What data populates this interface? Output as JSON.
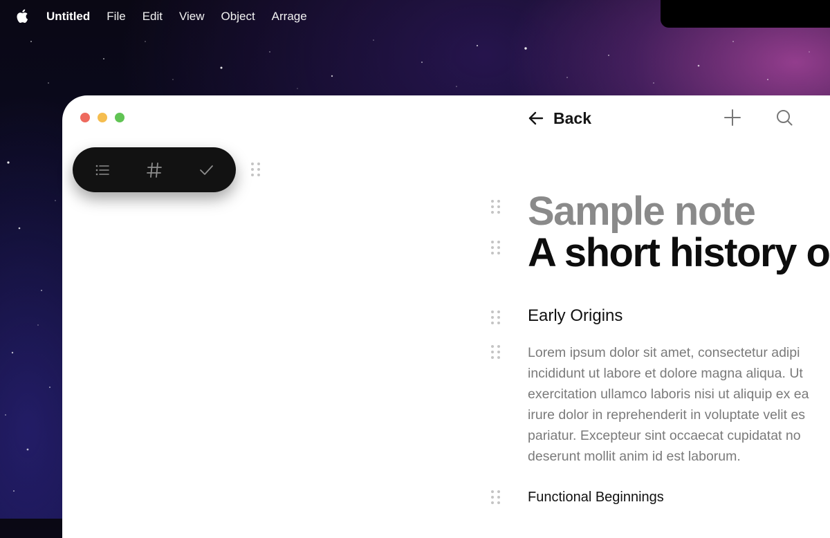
{
  "menubar": {
    "apple_icon": "apple-logo",
    "items": [
      "Untitled",
      "File",
      "Edit",
      "View",
      "Object",
      "Arrage"
    ]
  },
  "toolbar": {
    "buttons": [
      {
        "name": "list-icon"
      },
      {
        "name": "hashtag-icon"
      },
      {
        "name": "checkmark-icon"
      }
    ]
  },
  "header": {
    "back_label": "Back",
    "add_icon": "plus-icon",
    "search_icon": "search-icon"
  },
  "note": {
    "supertitle": "Sample note",
    "title": "A short history of",
    "sections": [
      {
        "heading": "Early Origins",
        "body_lines": [
          "Lorem ipsum dolor sit amet, consectetur adipi",
          "incididunt ut labore et dolore magna aliqua. Ut",
          "exercitation ullamco laboris nisi ut aliquip ex ea",
          "irure dolor in reprehenderit in voluptate velit es",
          "pariatur. Excepteur sint occaecat cupidatat no",
          "deserunt mollit anim id est laborum."
        ]
      },
      {
        "heading": "Functional Beginnings"
      }
    ]
  },
  "colors": {
    "traffic_red": "#ee6a5e",
    "traffic_yellow": "#f5bd4f",
    "traffic_green": "#61c454",
    "toolbar_bg": "#121212",
    "supertitle": "#8a8a8a",
    "body_text": "#7a7a7a"
  }
}
